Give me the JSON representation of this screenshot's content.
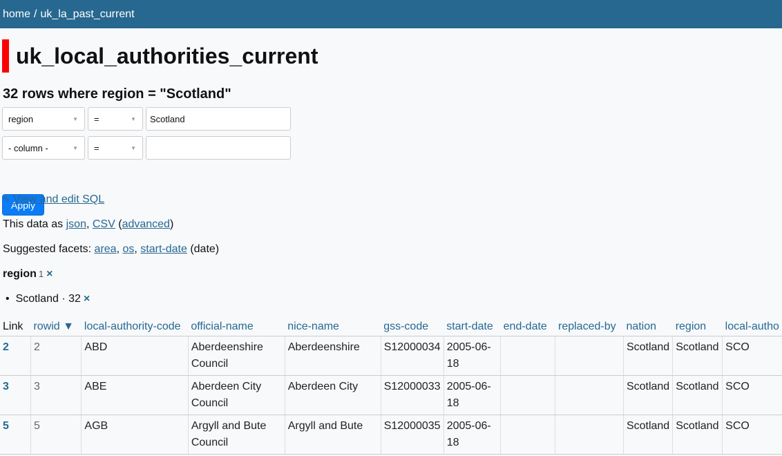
{
  "breadcrumb": {
    "home": "home",
    "sep": "/",
    "db": "uk_la_past_current"
  },
  "page_title": "uk_local_authorities_current",
  "row_count_label": "32 rows where region = \"Scotland\"",
  "filters": [
    {
      "column": "region",
      "op": "=",
      "value": "Scotland"
    },
    {
      "column": "- column -",
      "op": "=",
      "value": ""
    }
  ],
  "apply_label": "Apply",
  "sql_link": {
    "icon": "pencil-icon",
    "label": "View and edit SQL"
  },
  "export": {
    "prefix": "This data as",
    "json": "json",
    "comma": ",",
    "csv": "CSV",
    "open": "(",
    "advanced": "advanced",
    "close": ")"
  },
  "suggested": {
    "prefix": "Suggested facets:",
    "area": "area",
    "os": "os",
    "start_date": "start-date",
    "suffix": "(date)"
  },
  "facet": {
    "title": "region",
    "count": "1",
    "close_icon": "×"
  },
  "facet_item": {
    "label": "Scotland",
    "dot": "·",
    "count": "32",
    "close_icon": "×"
  },
  "table": {
    "columns": [
      "Link",
      "rowid ▼",
      "local-authority-code",
      "official-name",
      "nice-name",
      "gss-code",
      "start-date",
      "end-date",
      "replaced-by",
      "nation",
      "region",
      "local-autho"
    ],
    "rows": [
      {
        "link": "2",
        "rowid": "2",
        "code": "ABD",
        "official": "Aberdeenshire Council",
        "nice": "Aberdeenshire",
        "gss": "S12000034",
        "start": "2005-06-18",
        "end": "",
        "replaced": "",
        "nation": "Scotland",
        "region": "Scotland",
        "la": "SCO"
      },
      {
        "link": "3",
        "rowid": "3",
        "code": "ABE",
        "official": "Aberdeen City Council",
        "nice": "Aberdeen City",
        "gss": "S12000033",
        "start": "2005-06-18",
        "end": "",
        "replaced": "",
        "nation": "Scotland",
        "region": "Scotland",
        "la": "SCO"
      },
      {
        "link": "5",
        "rowid": "5",
        "code": "AGB",
        "official": "Argyll and Bute Council",
        "nice": "Argyll and Bute",
        "gss": "S12000035",
        "start": "2005-06-18",
        "end": "",
        "replaced": "",
        "nation": "Scotland",
        "region": "Scotland",
        "la": "SCO"
      }
    ]
  }
}
